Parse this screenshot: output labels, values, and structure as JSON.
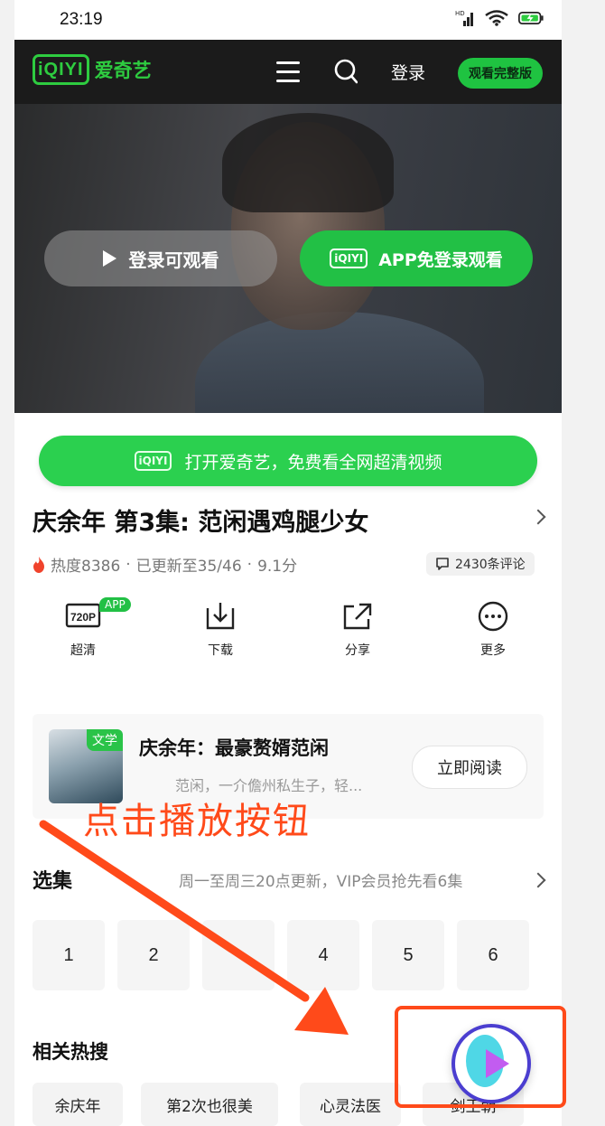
{
  "status_bar": {
    "time": "23:19"
  },
  "header": {
    "logo_mark": "iQIYI",
    "logo_text": "爱奇艺",
    "login_label": "登录",
    "full_version_label": "观看完整版",
    "brand_color": "#2ecc40"
  },
  "hero": {
    "login_watch_label": "登录可观看",
    "app_watch_label": "APP免登录观看",
    "app_logo_mark": "iQIYI"
  },
  "open_app_banner": {
    "logo_mark": "iQIYI",
    "label": "打开爱奇艺，免费看全网超清视频"
  },
  "episode": {
    "title": "庆余年 第3集: 范闲遇鸡腿少女",
    "heat": "热度8386",
    "separator1": "·",
    "update": "已更新至35/46",
    "separator2": "·",
    "score": "9.1分",
    "comments": "2430条评论"
  },
  "actions": [
    {
      "icon": "720p-quality-icon",
      "badge_text": "720P",
      "label": "超清",
      "app_badge": "APP"
    },
    {
      "icon": "download-icon",
      "label": "下载"
    },
    {
      "icon": "share-icon",
      "label": "分享"
    },
    {
      "icon": "more-icon",
      "label": "更多"
    }
  ],
  "book_card": {
    "tag": "文学",
    "title": "庆余年：最豪赘婿范闲",
    "description": "范闲，一介儋州私生子，轻...",
    "read_label": "立即阅读"
  },
  "overlay_instruction": "点击播放按钮",
  "episode_select": {
    "title": "选集",
    "note": "周一至周三20点更新，VIP会员抢先看6集",
    "episodes": [
      "1",
      "2",
      "",
      "4",
      "5",
      "6"
    ]
  },
  "related": {
    "title": "相关热搜",
    "tags": [
      "余庆年",
      "第2次也很美",
      "心灵法医",
      "剑王朝"
    ]
  },
  "colors": {
    "accent_green": "#22c045",
    "annotation_red": "#ff4a1a",
    "fab_ring": "#4b3ed0"
  }
}
